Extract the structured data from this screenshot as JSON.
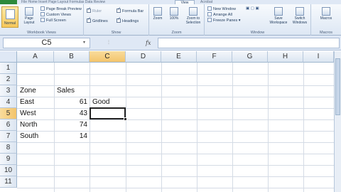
{
  "ribbon": {
    "tabs_left": "File    Home    Insert    Page Layout    Formulas    Data    Review",
    "active_tab": "View",
    "tab_after": "Acrobat",
    "workbook_views": {
      "normal": "Normal",
      "page_layout": "Page\nLayout",
      "page_break": "Page Break Preview",
      "custom_views": "Custom Views",
      "full_screen": "Full Screen",
      "label": "Workbook Views"
    },
    "show": {
      "ruler": "Ruler",
      "gridlines": "Gridlines",
      "formula_bar": "Formula Bar",
      "headings": "Headings",
      "label": "Show"
    },
    "zoom": {
      "zoom": "Zoom",
      "hundred": "100%",
      "zoom_selection": "Zoom to Selection",
      "label": "Zoom"
    },
    "window": {
      "new_window": "New Window",
      "arrange_all": "Arrange All",
      "freeze_panes": "Freeze Panes",
      "save_workspace": "Save Workspace",
      "switch_windows": "Switch Windows",
      "label": "Window"
    },
    "macros": {
      "macros": "Macros",
      "label": "Macros"
    }
  },
  "formula_bar": {
    "name_box": "C5",
    "fx": "fx",
    "formula": ""
  },
  "grid": {
    "columns": [
      "A",
      "B",
      "C",
      "D",
      "E",
      "F",
      "G",
      "H",
      "I"
    ],
    "selected_column": "C",
    "rows": [
      "1",
      "2",
      "3",
      "4",
      "5",
      "6",
      "7",
      "8",
      "9",
      "10",
      "11"
    ],
    "selected_row": "5",
    "cells": {
      "A3": "Zone",
      "B3": "Sales",
      "A4": "East",
      "B4": "61",
      "C4": "Good",
      "A5": "West",
      "B5": "43",
      "A6": "North",
      "B6": "74",
      "A7": "South",
      "B7": "14"
    }
  }
}
